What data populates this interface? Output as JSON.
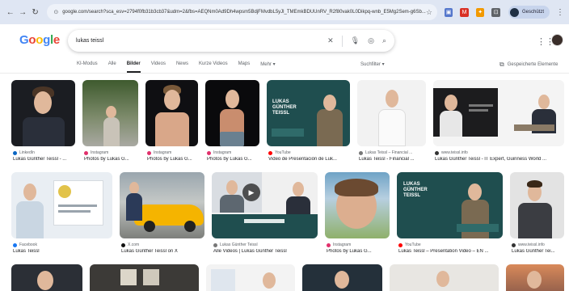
{
  "browser": {
    "url": "google.com/search?sca_esv=2794f0fb31b3cb37&udm=2&fbs=AEQNm0Ad9Dh4wpsm5BdjFMvdbL5yJl_TMEmkBDUUnRV_R2f80vak0L0Dikpq-wnb_E5Mg2Sem-g6Sb...",
    "profile_label": "Geschützt"
  },
  "google": {
    "logo": [
      "G",
      "o",
      "o",
      "g",
      "l",
      "e"
    ],
    "query": "lukas teissl"
  },
  "tabs": [
    {
      "label": "KI-Modus",
      "active": false
    },
    {
      "label": "Alle",
      "active": false
    },
    {
      "label": "Bilder",
      "active": true
    },
    {
      "label": "Videos",
      "active": false
    },
    {
      "label": "News",
      "active": false
    },
    {
      "label": "Kurze Videos",
      "active": false
    },
    {
      "label": "Maps",
      "active": false
    },
    {
      "label": "Mehr ▾",
      "active": false
    }
  ],
  "tools_label": "Suchfilter ▾",
  "saved_label": "Gespeicherte Elemente",
  "results_row1": [
    {
      "source": "LinkedIn",
      "caption": "Lukas Günther Teissl - ...",
      "fav": "#0a66c2"
    },
    {
      "source": "Instagram",
      "caption": "Photos by Lukas G...",
      "fav": "#e1306c"
    },
    {
      "source": "Instagram",
      "caption": "Photos by Lukas G...",
      "fav": "#e1306c"
    },
    {
      "source": "Instagram",
      "caption": "Photos by Lukas G...",
      "fav": "#e1306c"
    },
    {
      "source": "YouTube",
      "caption": "Video de Presentación de Luk...",
      "fav": "#ff0000"
    },
    {
      "source": "Lukas Teissl – Financial ...",
      "caption": "Lukas Teissl - Financial ...",
      "fav": "#777777"
    },
    {
      "source": "www.teissl.info",
      "caption": "Lukas Günther Teissl - IT Expert, Guinness World ...",
      "fav": "#333333"
    }
  ],
  "results_row2": [
    {
      "source": "Facebook",
      "caption": "Lukas Teissl",
      "fav": "#1877f2"
    },
    {
      "source": "X.com",
      "caption": "Lukas Günther Teissl on X",
      "fav": "#111111"
    },
    {
      "source": "Lukas Günther Teissl",
      "caption": "Alle Videos | Lukas Günther Teissl",
      "fav": "#777777"
    },
    {
      "source": "Instagram",
      "caption": "Photos by Lukas G...",
      "fav": "#e1306c"
    },
    {
      "source": "YouTube",
      "caption": "Lukas Teissl – Presentation Video – EN ...",
      "fav": "#ff0000"
    },
    {
      "source": "www.teissl.info",
      "caption": "Lukas Günther Tei...",
      "fav": "#333333"
    }
  ],
  "slide_texts": {
    "row1_teal_title": "LUKAS GÜNTHER TEISSL",
    "row2_teal_title": "LUKAS GÜNTHER TEISSL",
    "video_channel": "Lukas Günther Teissl"
  },
  "colors": {
    "accent": "#1a73e8",
    "teal": "#1f4e4f"
  }
}
